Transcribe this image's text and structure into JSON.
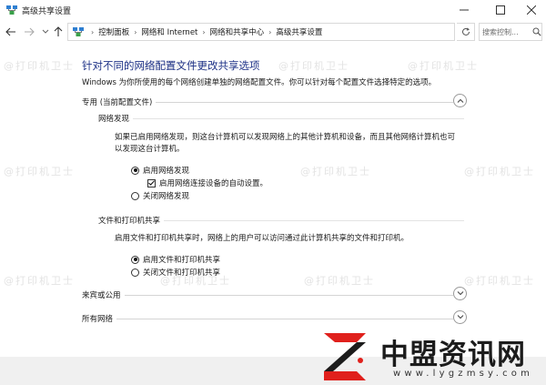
{
  "window": {
    "title": "高级共享设置"
  },
  "breadcrumb": [
    "控制面板",
    "网络和 Internet",
    "网络和共享中心",
    "高级共享设置"
  ],
  "search": {
    "placeholder": "搜索控制..."
  },
  "page": {
    "title": "针对不同的网络配置文件更改共享选项",
    "description": "Windows 为你所使用的每个网络创建单独的网络配置文件。你可以针对每个配置文件选择特定的选项。"
  },
  "sections": {
    "private": {
      "label": "专用 (当前配置文件)",
      "state": "expanded"
    },
    "network_discovery": {
      "label": "网络发现",
      "description": "如果已启用网络发现，则这台计算机可以发现网络上的其他计算机和设备，而且其他网络计算机也可以发现这台计算机。",
      "opt_on": "启用网络发现",
      "opt_auto": "启用网络连接设备的自动设置。",
      "opt_off": "关闭网络发现"
    },
    "file_printer": {
      "label": "文件和打印机共享",
      "description": "启用文件和打印机共享时，网络上的用户可以访问通过此计算机共享的文件和打印机。",
      "opt_on": "启用文件和打印机共享",
      "opt_off": "关闭文件和打印机共享"
    },
    "guest": {
      "label": "来宾或公用",
      "state": "collapsed"
    },
    "all": {
      "label": "所有网络",
      "state": "collapsed"
    }
  },
  "watermark": {
    "text": "@打印机卫士"
  },
  "brand": {
    "name": "中盟资讯网",
    "url": "www.lygzmsy.com",
    "accent": "#e0201c"
  },
  "colors": {
    "title": "#1e3287"
  }
}
